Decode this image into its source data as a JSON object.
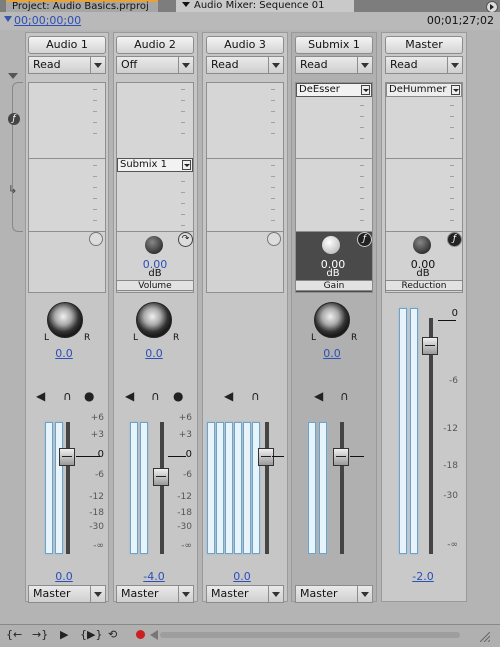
{
  "tabs": {
    "project": "Project: Audio Basics.prproj",
    "mixer": "Audio Mixer: Sequence 01"
  },
  "timecode": {
    "current": "00;00;00;00",
    "duration": "00;01;27;02"
  },
  "channels": [
    {
      "name": "Audio 1",
      "automation": "Read",
      "pan_value": "0.0",
      "volume": "0.0",
      "output": "Master",
      "fader_db": 0.0
    },
    {
      "name": "Audio 2",
      "automation": "Off",
      "send": "Submix 1",
      "send_value": "0.00",
      "send_unit": "dB",
      "send_param": "Volume",
      "pan_value": "0.0",
      "volume": "-4.0",
      "output": "Master",
      "fader_db": -4.0
    },
    {
      "name": "Audio 3",
      "automation": "Read",
      "pan_value": "",
      "volume": "0.0",
      "output": "Master",
      "fader_db": 0.0
    },
    {
      "name": "Submix 1",
      "automation": "Read",
      "effect": "DeEsser",
      "effect_value": "0.00",
      "effect_unit": "dB",
      "effect_param": "Gain",
      "pan_value": "0.0",
      "volume": "",
      "output": "Master",
      "fader_db": 0.0
    },
    {
      "name": "Master",
      "automation": "Read",
      "effect": "DeHummer",
      "effect_value": "0.00",
      "effect_unit": "dB",
      "effect_param": "Reduction",
      "volume": "-2.0",
      "fader_db": -2.0
    }
  ],
  "scale_labels": [
    "+6",
    "+3",
    "0",
    "-6",
    "-12",
    "-18",
    "-30",
    "-∞"
  ],
  "master_scale_labels": [
    "0",
    "-6",
    "-12",
    "-18",
    "-30",
    "-∞"
  ],
  "pan_left": "L",
  "pan_right": "R",
  "icons": {
    "mute": "speaker-icon",
    "solo": "headphone-icon",
    "record": "microphone-icon",
    "fx": "fx-icon",
    "send": "send-icon"
  },
  "transport": [
    "go-to-in-icon",
    "go-to-out-icon",
    "play-icon",
    "play-in-to-out-icon",
    "loop-icon",
    "record-icon"
  ],
  "colors": {
    "link": "#2c4fb8",
    "record": "#cc1f1f",
    "tab_highlight": "#e8a23a"
  }
}
